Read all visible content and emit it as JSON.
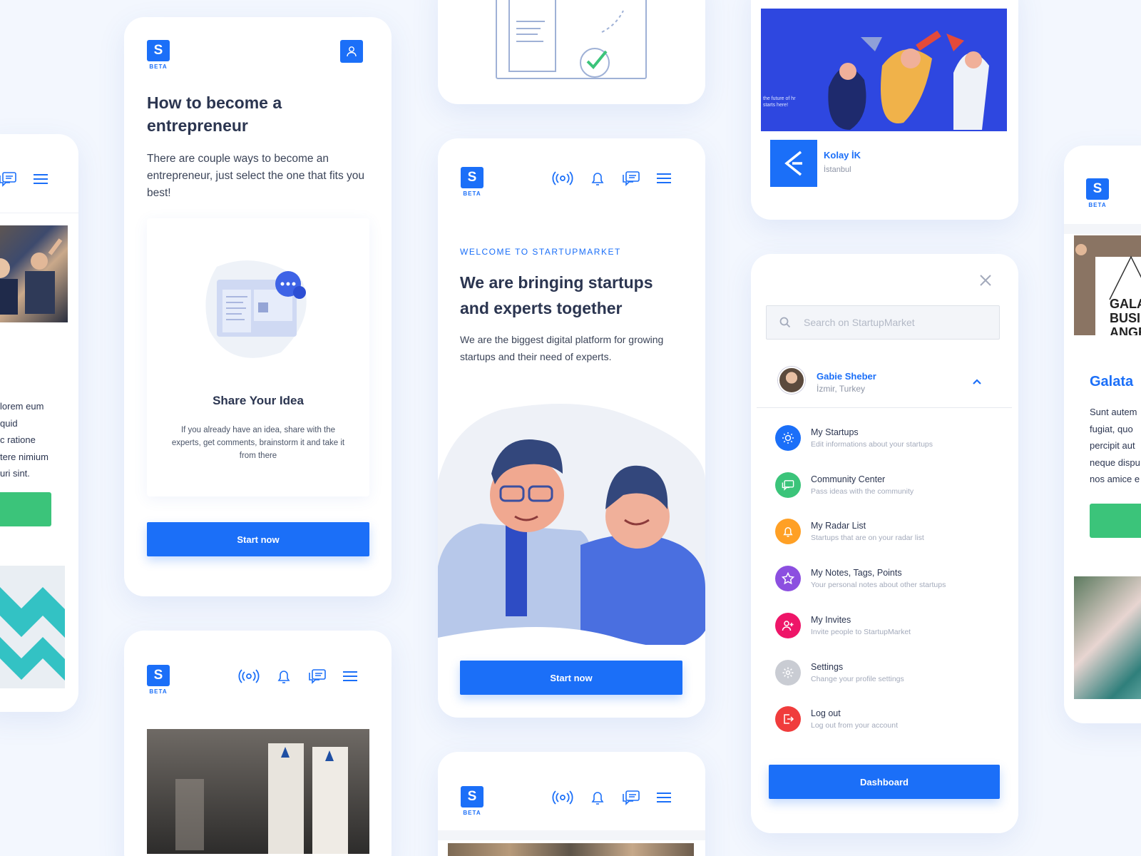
{
  "brand": {
    "logo_letter": "S",
    "beta": "BETA",
    "accent": "#1b6ff8"
  },
  "left_card": {
    "lines": [
      "lorem eum",
      "quid",
      "c ratione",
      "tere nimium",
      "uri sint."
    ]
  },
  "entrepreneur_card": {
    "title": "How to become a entrepreneur",
    "intro": "There are couple ways to become an entrepreneur, just select the one that fits you best!",
    "feature_title": "Share Your Idea",
    "feature_text": "If you already have an idea, share with the experts, get comments, brainstorm it and take it from there",
    "cta": "Start now"
  },
  "hero_card": {
    "eyebrow": "WELCOME TO STARTUPMARKET",
    "title": "We are bringing startups and experts together",
    "text": "We are the biggest digital platform for growing startups and their need of experts.",
    "cta": "Start now"
  },
  "company_card": {
    "banner_text": "the future of hr starts here!",
    "name": "Kolay İK",
    "city": "İstanbul"
  },
  "menu_card": {
    "search_placeholder": "Search on StartupMarket",
    "user_name": "Gabie Sheber",
    "user_location": "İzmir, Turkey",
    "items": [
      {
        "title": "My Startups",
        "subtitle": "Edit informations about your startups",
        "color": "#1b6ff8",
        "icon": "sun-icon"
      },
      {
        "title": "Community Center",
        "subtitle": "Pass ideas with the community",
        "color": "#3bc47a",
        "icon": "chat-icon"
      },
      {
        "title": "My Radar List",
        "subtitle": "Startups that are on your radar list",
        "color": "#ffa025",
        "icon": "bell-icon"
      },
      {
        "title": "My Notes, Tags, Points",
        "subtitle": "Your personal notes about other startups",
        "color": "#8c4fe0",
        "icon": "star-icon"
      },
      {
        "title": "My Invites",
        "subtitle": "Invite people to StartupMarket",
        "color": "#ee1568",
        "icon": "add-user-icon"
      },
      {
        "title": "Settings",
        "subtitle": "Change your profile settings",
        "color": "#c9ccd3",
        "icon": "gear-icon"
      },
      {
        "title": "Log out",
        "subtitle": "Log out from your account",
        "color": "#f03c3c",
        "icon": "logout-icon"
      }
    ],
    "cta": "Dashboard"
  },
  "right_card": {
    "title": "Galata",
    "sign_text": "GALA BUSIN ANGE",
    "lines": [
      "Sunt autem",
      "fugiat, quo",
      "percipit aut",
      "neque dispu",
      "nos amice e"
    ]
  }
}
